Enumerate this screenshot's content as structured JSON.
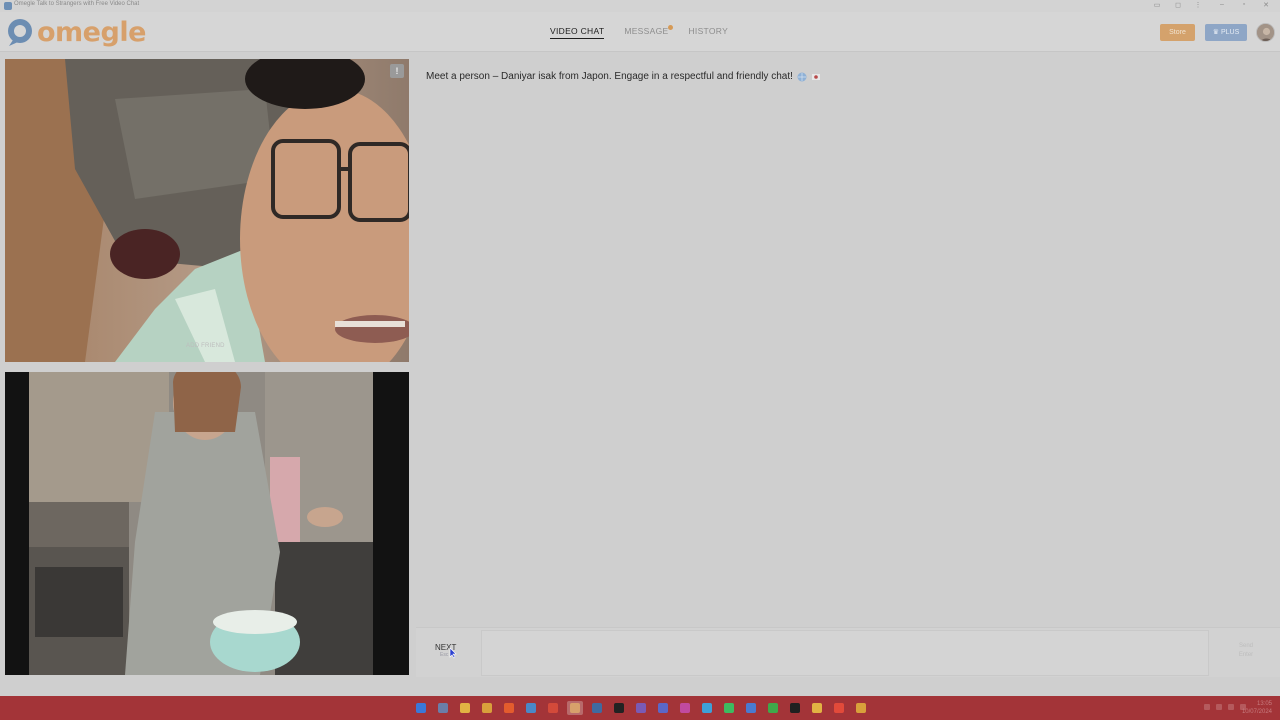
{
  "window": {
    "title": "Omegle Talk to Strangers with Free Video Chat",
    "controls": [
      "minimize",
      "maximize",
      "close"
    ]
  },
  "header": {
    "logo_text": "omegle",
    "nav": [
      {
        "label": "VIDEO CHAT",
        "active": true
      },
      {
        "label": "MESSAGE",
        "active": false,
        "has_notification": true
      },
      {
        "label": "HISTORY",
        "active": false
      }
    ],
    "store_label": "Store",
    "plus_label": "♛ PLUS",
    "colors": {
      "store": "#d4a26c",
      "plus": "#8ea6c6",
      "logo": "#d7a06b"
    }
  },
  "videos": {
    "stranger": {
      "report_label": "!",
      "add_friend_label": "ADD FRIEND"
    },
    "self": {}
  },
  "chat": {
    "intro_message": "Meet a person – Daniyar isak from Japon. Engage in a respectful and friendly chat!",
    "next_label": "NEXT",
    "next_hint": "Esc",
    "message_placeholder": "",
    "send_label_1": "Send",
    "send_label_2": "Enter"
  },
  "taskbar": {
    "apps": [
      {
        "icon": "windows-start-icon",
        "color": "#3a78d8"
      },
      {
        "icon": "task-view-icon",
        "color": "#6b7ea8"
      },
      {
        "icon": "file-explorer-icon",
        "color": "#e2b343"
      },
      {
        "icon": "chrome-icon",
        "color": "#d9a03b"
      },
      {
        "icon": "brave-icon",
        "color": "#e45c2d"
      },
      {
        "icon": "vpn-icon",
        "color": "#4a88c7"
      },
      {
        "icon": "video-editor-icon",
        "color": "#d34a3a"
      },
      {
        "icon": "omegle-app-icon",
        "color": "#d7a06b",
        "active": true
      },
      {
        "icon": "steam-icon",
        "color": "#3f6aa0"
      },
      {
        "icon": "capcut-icon",
        "color": "#222222"
      },
      {
        "icon": "obs-icon",
        "color": "#7a5ab5"
      },
      {
        "icon": "teams-icon",
        "color": "#5b67c7"
      },
      {
        "icon": "instagram-icon",
        "color": "#c14aa0"
      },
      {
        "icon": "telegram-icon",
        "color": "#3da0d8"
      },
      {
        "icon": "whatsapp-icon",
        "color": "#3dbb60"
      },
      {
        "icon": "app-icon",
        "color": "#4a7ad0"
      },
      {
        "icon": "play-icon",
        "color": "#3fa84a"
      },
      {
        "icon": "tiktok-icon",
        "color": "#202020"
      },
      {
        "icon": "folder-icon",
        "color": "#e2b343"
      },
      {
        "icon": "k-app-icon",
        "color": "#e24a3a"
      },
      {
        "icon": "chrome-canary-icon",
        "color": "#d9a03b"
      }
    ],
    "clock_time": "13:05",
    "clock_date": "10/07/2024"
  }
}
